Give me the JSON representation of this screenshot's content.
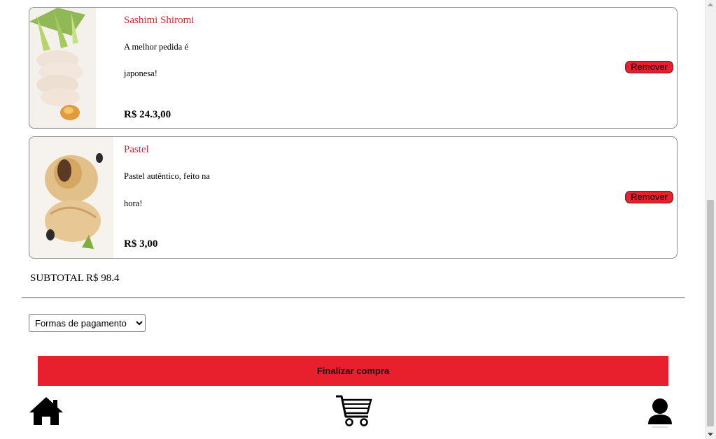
{
  "cart": {
    "items": [
      {
        "name": "Sashimi Shiromi",
        "description_line1": "A melhor pedida é",
        "description_line2": "japonesa!",
        "price": "R$ 24.3,00",
        "remove_label": "Remover",
        "image_icon": "sashimi-photo"
      },
      {
        "name": "Pastel",
        "description_line1": "Pastel autêntico, feito na",
        "description_line2": "hora!",
        "price": "R$ 3,00",
        "remove_label": "Remover",
        "image_icon": "pastel-photo"
      }
    ],
    "subtotal": "SUBTOTAL R$ 98.4"
  },
  "checkout": {
    "payment_select_value": "Formas de pagamento",
    "finish_label": "Finalizar compra"
  },
  "nav": {
    "home_icon": "home-icon",
    "cart_icon": "cart-icon",
    "profile_icon": "user-icon"
  },
  "colors": {
    "accent": "#e8202e",
    "border": "#8a8a8a"
  }
}
